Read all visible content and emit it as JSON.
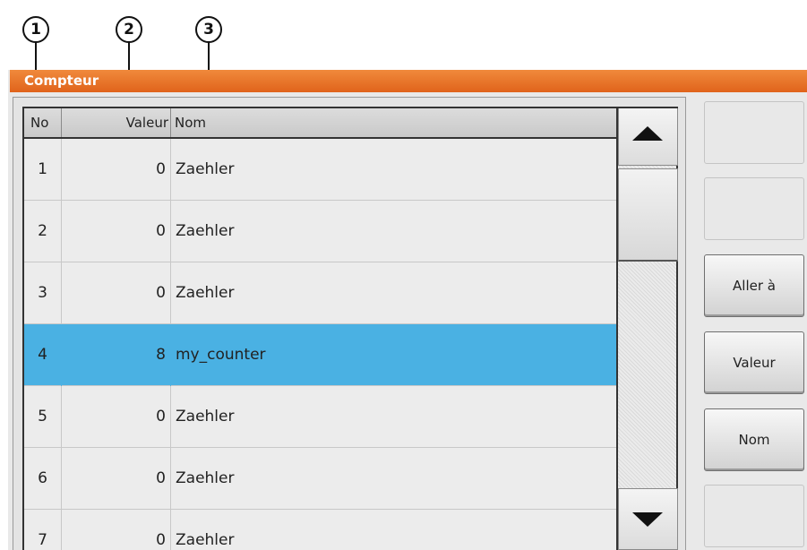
{
  "callouts": [
    "1",
    "2",
    "3"
  ],
  "window": {
    "title": "Compteur"
  },
  "table": {
    "columns": {
      "no": "No",
      "valeur": "Valeur",
      "nom": "Nom"
    },
    "rows": [
      {
        "no": "1",
        "valeur": "0",
        "nom": "Zaehler",
        "selected": false
      },
      {
        "no": "2",
        "valeur": "0",
        "nom": "Zaehler",
        "selected": false
      },
      {
        "no": "3",
        "valeur": "0",
        "nom": "Zaehler",
        "selected": false
      },
      {
        "no": "4",
        "valeur": "8",
        "nom": "my_counter",
        "selected": true
      },
      {
        "no": "5",
        "valeur": "0",
        "nom": "Zaehler",
        "selected": false
      },
      {
        "no": "6",
        "valeur": "0",
        "nom": "Zaehler",
        "selected": false
      },
      {
        "no": "7",
        "valeur": "0",
        "nom": "Zaehler",
        "selected": false
      }
    ]
  },
  "scrollbar": {
    "up_icon": "triangle-up-icon",
    "down_icon": "triangle-down-icon"
  },
  "side_buttons": {
    "btn1": "",
    "btn2": "",
    "aller": "Aller à",
    "valeur": "Valeur",
    "nom": "Nom",
    "btn6": ""
  },
  "colors": {
    "title_bar": "#e8712a",
    "selection": "#4ab1e3"
  }
}
